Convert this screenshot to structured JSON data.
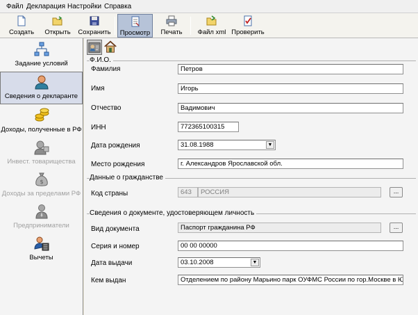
{
  "menu": [
    "Файл",
    "Декларация",
    "Настройки",
    "Справка"
  ],
  "toolbar": {
    "create": "Создать",
    "open": "Открыть",
    "save": "Сохранить",
    "preview": "Просмотр",
    "print": "Печать",
    "xml": "Файл xml",
    "check": "Проверить"
  },
  "nav": {
    "conditions": "Задание условий",
    "declarant": "Сведения о декларанте",
    "income_rf": "Доходы, полученные в РФ",
    "invest": "Инвест. товарищества",
    "income_abroad": "Доходы за пределами РФ",
    "entrepreneurs": "Предприниматели",
    "deductions": "Вычеты"
  },
  "sections": {
    "fio": "Ф.И.О.",
    "citizenship": "Данные о гражданстве",
    "document": "Сведения о документе, удостоверяющем личность"
  },
  "labels": {
    "surname": "Фамилия",
    "name": "Имя",
    "patronymic": "Отчество",
    "inn": "ИНН",
    "birth_date": "Дата рождения",
    "birth_place": "Место рождения",
    "country_code": "Код страны",
    "doc_type": "Вид документа",
    "series_number": "Серия и номер",
    "issue_date": "Дата выдачи",
    "issued_by": "Кем выдан"
  },
  "values": {
    "surname": "Петров",
    "name": "Игорь",
    "patronymic": "Вадимович",
    "inn": "772365100315",
    "birth_date": "31.08.1988",
    "birth_place": "г. Александров Ярославской обл.",
    "country_code": "643",
    "country_name": "РОССИЯ",
    "doc_type": "Паспорт гражданина РФ",
    "series_number": "00 00 00000",
    "issue_date": "03.10.2008",
    "issued_by": "Отделением по району Марьино парк ОУФМС России по гор.Москве в ЮВАО"
  },
  "ellipsis": "...",
  "colors": {
    "selected_bg": "#d7dcea",
    "active_tool": "#b6c3d8"
  },
  "icons": [
    "new-document-icon",
    "open-folder-icon",
    "floppy-disk-icon",
    "preview-icon",
    "printer-icon",
    "xml-file-icon",
    "check-document-icon"
  ]
}
